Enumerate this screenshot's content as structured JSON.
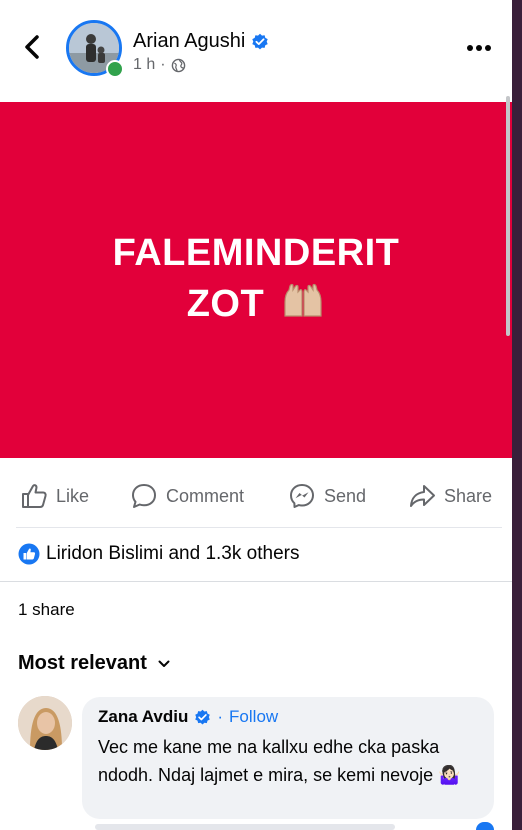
{
  "header": {
    "author": "Arian Agushi",
    "time": "1 h",
    "separator": "·"
  },
  "post": {
    "line1": "FALEMINDERIT",
    "line2": "ZOT",
    "background": "#e2003a"
  },
  "actions": {
    "like": "Like",
    "comment": "Comment",
    "send": "Send",
    "share": "Share"
  },
  "reactions": {
    "text": "Liridon Bislimi and 1.3k others"
  },
  "shares": {
    "text": "1 share"
  },
  "comments": {
    "sort_label": "Most relevant",
    "items": [
      {
        "author": "Zana Avdiu",
        "separator": "·",
        "follow": "Follow",
        "text": "Vec me kane me na kallxu edhe cka paska ndodh. Ndaj lajmet e mira, se kemi nevoje 🤷🏻‍♀️"
      }
    ]
  },
  "colors": {
    "accent": "#1877f2",
    "online": "#31a24c",
    "muted": "#65676b"
  }
}
